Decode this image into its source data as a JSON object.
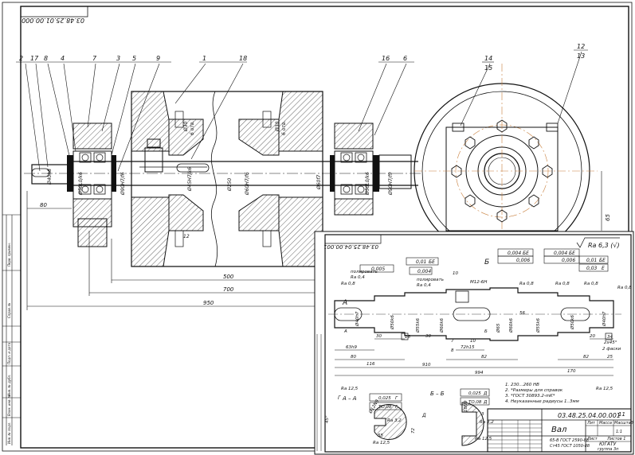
{
  "main_drawing": {
    "code_mirrored": "03.48.25.01.00.000",
    "balloons": [
      "2",
      "17",
      "8",
      "4",
      "7",
      "3",
      "5",
      "9",
      "1",
      "18",
      "16",
      "6",
      "14",
      "15",
      "12",
      "13"
    ],
    "dimensions": {
      "d1": "Ø40h8",
      "d2": "Ø50L0/k6",
      "d3": "Ø56",
      "d4": "Ø90H7/f6",
      "d5": "Ø30",
      "d5n": "6 отв.",
      "d6": "Ø45H7/k6",
      "d7": "Ø250",
      "d8": "Ø60H7/f6",
      "d9": "Ø30",
      "d9n": "6 отв.",
      "d10": "Ø60f7",
      "d11": "Ø50L0/k6",
      "d12": "Ø90H7/f9",
      "w12": "12",
      "l80": "80",
      "l500": "500",
      "l700": "700",
      "l950": "950",
      "l65": "65"
    }
  },
  "detail_drawing": {
    "code_mirrored": "03.48.25.04.00.001",
    "roughness_general": "Ra 6,3 (√)",
    "tolerances": {
      "t1": "0,005",
      "t2": "0,01",
      "t2b": "БЕ",
      "t3": "0,004",
      "t4": "0,004",
      "t4b": "БЕ",
      "t5": "0,006",
      "t6": "0,004",
      "t6b": "БЕ",
      "t7": "0,006",
      "t8": "0,01",
      "t8b": "БЕ",
      "t9": "0,03",
      "t9b": "Е"
    },
    "notes_top": {
      "polirovat1": "полировать",
      "polirovat2": "полировать",
      "ra08a": "Ra 0,8",
      "ra04a": "Ra 0,4",
      "ra04b": "Ra 0,4",
      "ra08b": "Ra 0,8",
      "ra08c": "Ra 0,8",
      "ra08d": "Ra 0,8",
      "ra08e": "Ra 0,8",
      "m12": "M12-6Н",
      "b_top": "Б",
      "a_top": "А",
      "l10": "10"
    },
    "shaft_dims": {
      "d1": "Ø40h7",
      "d2": "Ø50k6",
      "d3": "Ø55k6",
      "d4": "Ø60k6",
      "d5": "Ø65",
      "d6": "Ø60k6",
      "d7": "Ø55k6",
      "d8": "Ø50k6",
      "d9": "Ø40h7",
      "l16": "16",
      "l56": "56",
      "l34": "34"
    },
    "bottom_dims": {
      "a_bot": "А",
      "b_bot": "Б",
      "l63": "63h9",
      "l80": "80",
      "l116": "116",
      "l30a": "30",
      "l30b": "30",
      "l7": "7",
      "l8": "8",
      "l10": "10",
      "l72": "72h15",
      "l82": "82",
      "l910": "910",
      "l994": "994",
      "l20": "20",
      "ch2": "2х45°",
      "ch2n": "2 фаски",
      "l25": "25",
      "l82b": "82",
      "l170": "170"
    },
    "notes": [
      "1. 230...260 НВ",
      "2. *Размеры для справок",
      "3. *ГОСТ 30893.2-mK*",
      "4. Неуказанные радиусы 1..3мм"
    ],
    "ra125a": "Ra 12,5",
    "ra125b": "Ra 12,5",
    "section_a": {
      "title": "А – А",
      "t1": "0,025",
      "t1b": "Г",
      "t2": "ТО,08",
      "t2b": "Г",
      "g": "Г",
      "ang": "45°",
      "l55": "55",
      "ra32": "Ra 3,2",
      "ra125": "Ra 12,5",
      "dk": "Ø12N9"
    },
    "section_b": {
      "title": "Б – Б",
      "t1": "0,025",
      "t1b": "Д",
      "t2": "ТО,08",
      "t2b": "Д",
      "d": "Д",
      "l18": "18N9",
      "l72": "72",
      "ra32": "Ra 3,2",
      "ra125": "Ra 12,5",
      "l3": "3"
    },
    "title_block": {
      "code": "03.48.25.04.00.001",
      "name": "Вал",
      "material1": "65-В ГОСТ 2590-88",
      "material2": "Ст45 ГОСТ 1050-88",
      "org": "ЮГАТУ",
      "group": "группа 3п",
      "scale": "1:1",
      "sheet": "11",
      "h_lit": "Лит",
      "h_mass": "Масса",
      "h_scale": "Масштаб",
      "sheets": "Листов 1",
      "sheet_lbl": "Лист"
    }
  },
  "side_strip": {
    "s1": "Перв. примен.",
    "s2": "Справ. №",
    "s3": "Подп. и дата",
    "s4": "Инв. № дубл.",
    "s5": "Взам. инв. №",
    "s6": "Подп. и дата",
    "s7": "Инв. № подл."
  }
}
